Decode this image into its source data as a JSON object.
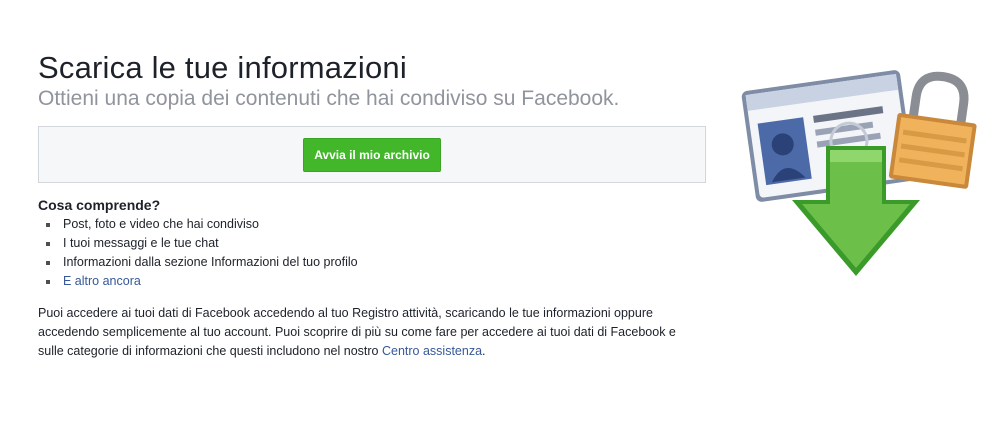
{
  "header": {
    "title": "Scarica le tue informazioni",
    "subtitle": "Ottieni una copia dei contenuti che hai condiviso su Facebook."
  },
  "action": {
    "button_label": "Avvia il mio archivio"
  },
  "includes": {
    "heading": "Cosa comprende?",
    "items": [
      "Post, foto e video che hai condiviso",
      "I tuoi messaggi e le tue chat",
      "Informazioni dalla sezione Informazioni del tuo profilo"
    ],
    "more_link": "E altro ancora"
  },
  "info": {
    "paragraph": "Puoi accedere ai tuoi dati di Facebook accedendo al tuo Registro attività, scaricando le tue informazioni oppure accedendo semplicemente al tuo account. Puoi scoprire di più su come fare per accedere ai tuoi dati di Facebook e sulle categorie di informazioni che questi includono nel nostro",
    "help_link": "Centro assistenza",
    "period": "."
  },
  "colors": {
    "button_green": "#42b72a",
    "link_blue": "#365899",
    "subtitle_gray": "#90949c"
  },
  "icons": {
    "illustration": "download-id-card-lock-icon"
  }
}
